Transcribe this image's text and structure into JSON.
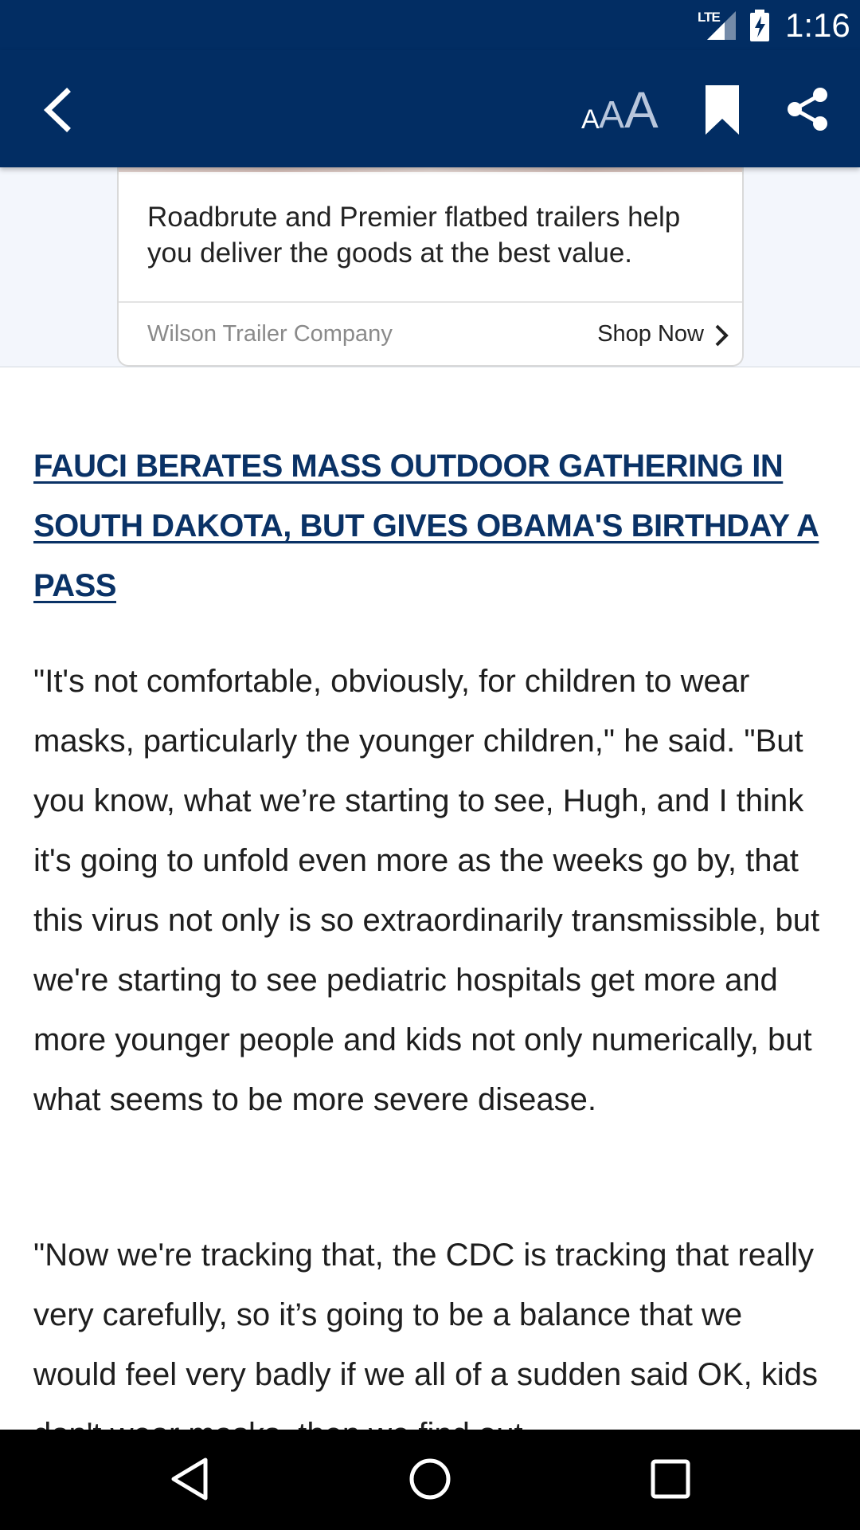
{
  "status_bar": {
    "network": "LTE",
    "time": "1:16"
  },
  "toolbar": {
    "font_size_glyph": "A"
  },
  "ad": {
    "text": "Roadbrute and Premier flatbed trailers help you deliver the goods at the best value.",
    "sponsor": "Wilson Trailer Company",
    "cta": "Shop Now"
  },
  "article": {
    "headline": "FAUCI BERATES MASS OUTDOOR GATHERING IN SOUTH DAKOTA, BUT GIVES OBAMA'S BIRTHDAY A PASS",
    "paragraphs": [
      "\"It's not comfortable, obviously, for children to wear masks, particularly the younger children,\" he said. \"But you know, what we’re starting to see, Hugh, and I think it's going to unfold even more as the weeks go by, that this virus not only is so extraordinarily transmissible, but we're starting to see pediatric hospitals get more and more younger people and kids not only numerically, but what seems to be more severe disease.",
      "\"Now we're tracking that, the CDC is tracking that really very carefully, so it’s going to be a balance that we would feel very badly if we all of a sudden said OK, kids don't wear masks, then we find out"
    ]
  },
  "colors": {
    "app_bar": "#022d63",
    "headline": "#0a3266",
    "ad_background": "#f3f6fc"
  },
  "icons": {
    "back": "chevron-left-icon",
    "font_size": "font-size-icon",
    "bookmark": "bookmark-icon",
    "share": "share-icon",
    "nav_back": "triangle-back-icon",
    "nav_home": "circle-home-icon",
    "nav_recent": "square-recents-icon"
  }
}
